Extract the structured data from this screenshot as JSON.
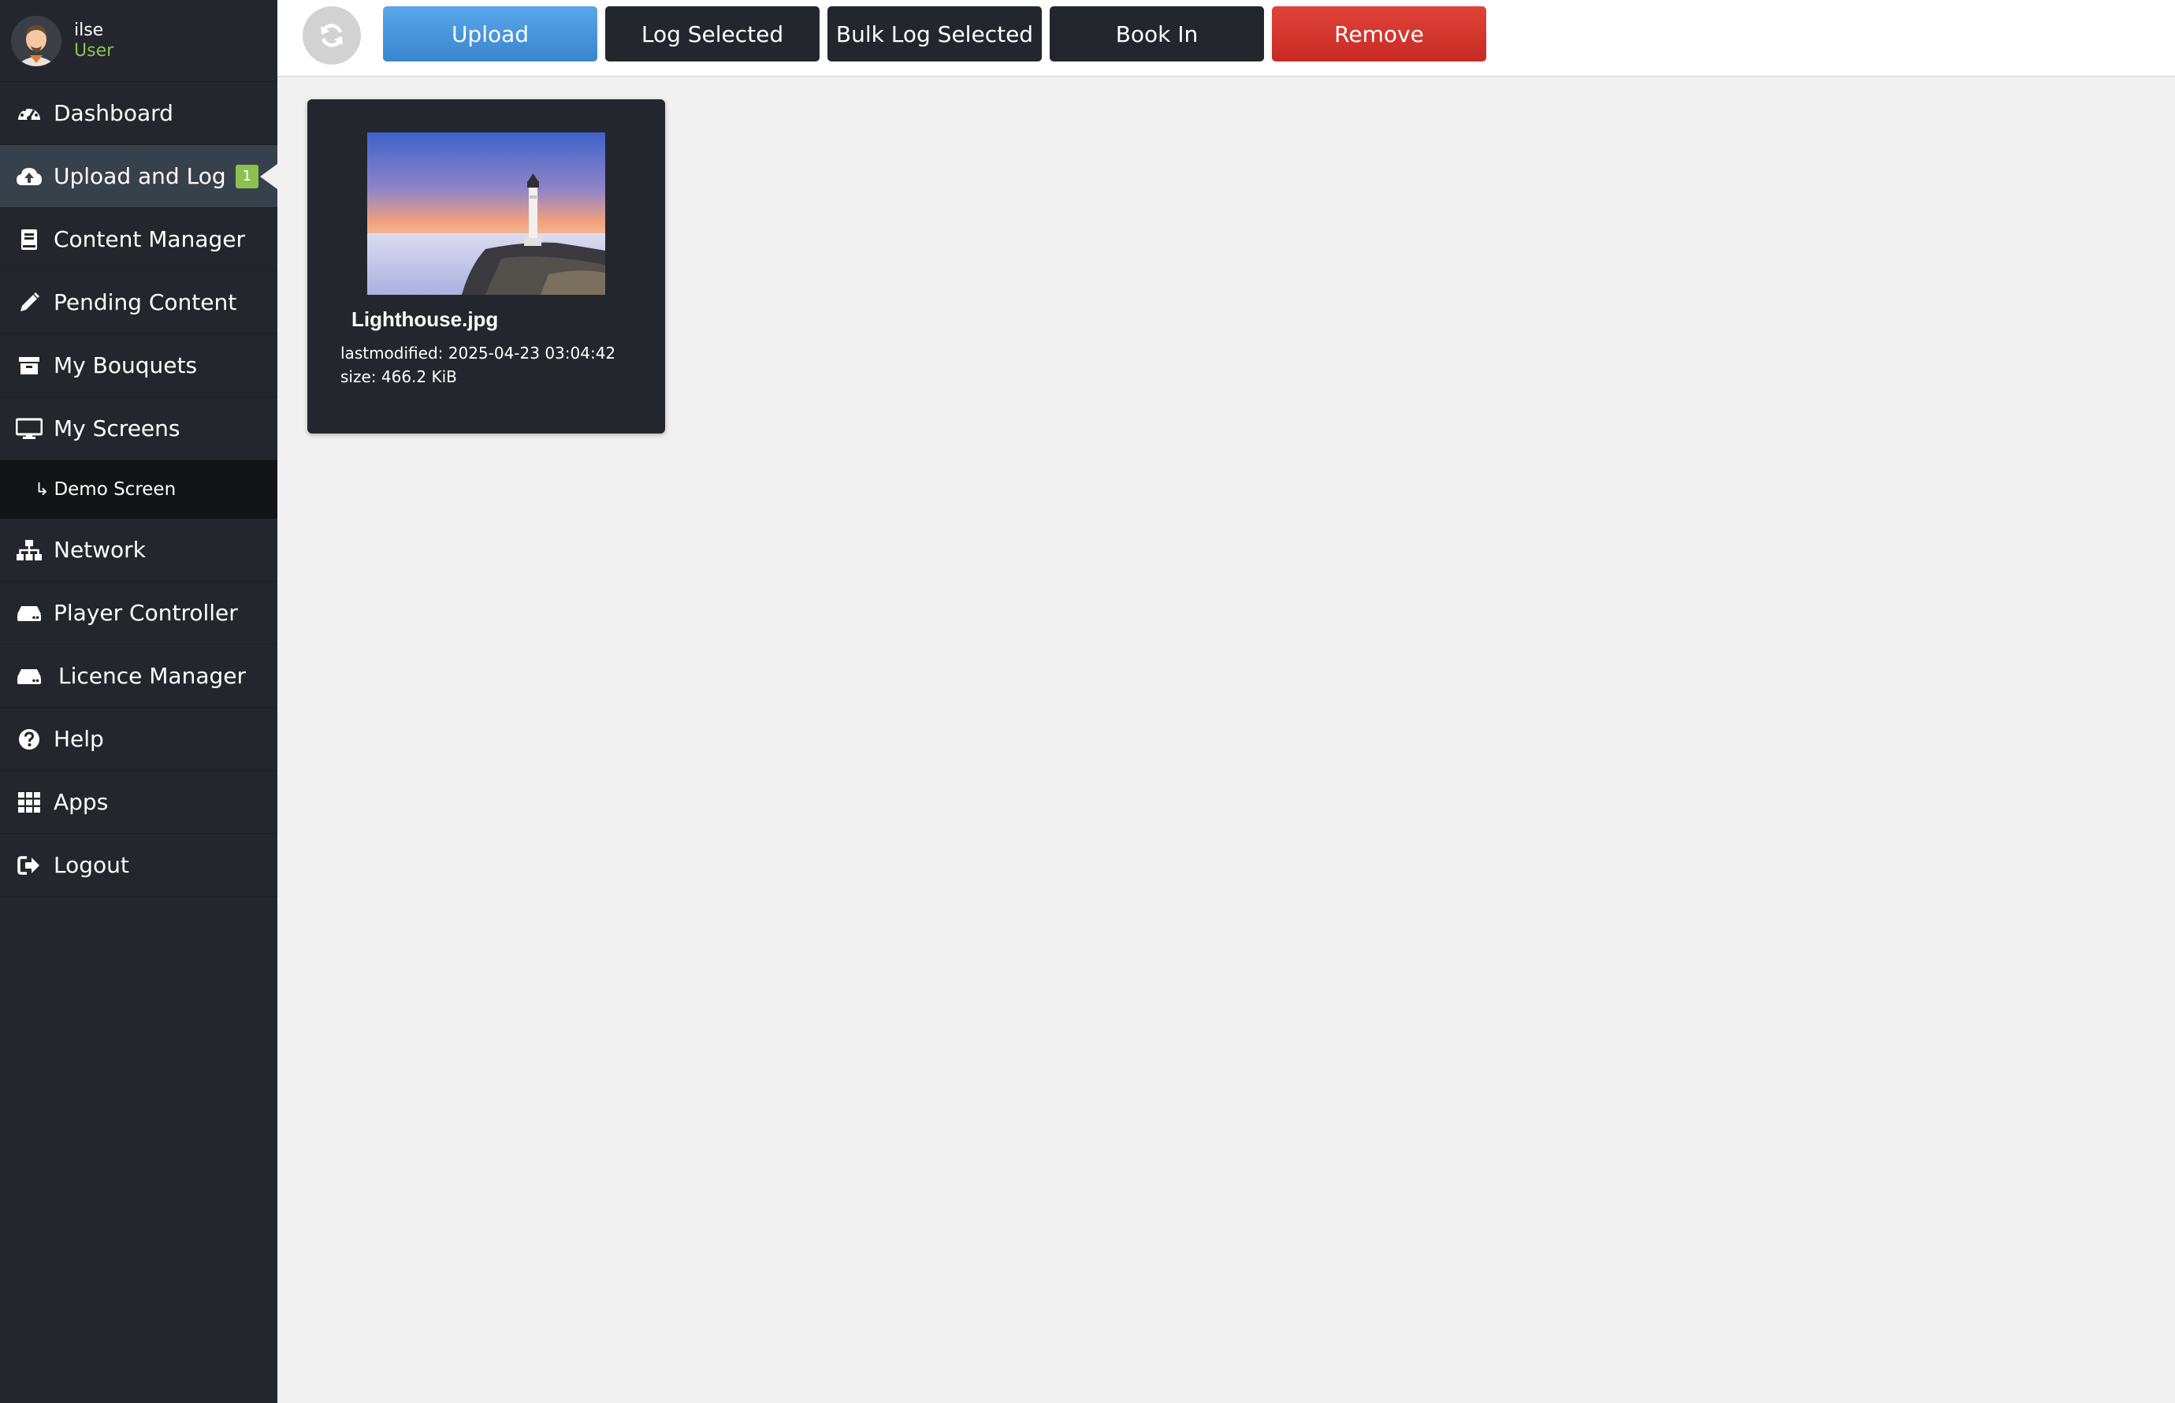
{
  "user": {
    "name": "ilse",
    "role": "User"
  },
  "sidebar": {
    "items": [
      {
        "label": "Dashboard",
        "icon": "dashboard-icon"
      },
      {
        "label": "Upload and Log",
        "icon": "cloud-upload-icon",
        "badge": "1",
        "active": true
      },
      {
        "label": "Content Manager",
        "icon": "book-icon"
      },
      {
        "label": "Pending Content",
        "icon": "pencil-icon"
      },
      {
        "label": "My Bouquets",
        "icon": "archive-icon"
      },
      {
        "label": "My Screens",
        "icon": "monitor-icon"
      },
      {
        "label": "Network",
        "icon": "sitemap-icon"
      },
      {
        "label": "Player Controller",
        "icon": "hdd-icon"
      },
      {
        "label": "Licence Manager",
        "icon": "hdd-icon"
      },
      {
        "label": "Help",
        "icon": "question-circle-icon"
      },
      {
        "label": "Apps",
        "icon": "grid-icon"
      },
      {
        "label": "Logout",
        "icon": "sign-out-icon"
      }
    ],
    "sub_items": [
      {
        "label": "Demo Screen",
        "arrow": "↳"
      }
    ]
  },
  "toolbar": {
    "refresh_icon": "refresh-icon",
    "upload_label": "Upload",
    "log_selected_label": "Log Selected",
    "bulk_log_selected_label": "Bulk Log Selected",
    "book_in_label": "Book In",
    "remove_label": "Remove"
  },
  "files": [
    {
      "name": "Lighthouse.jpg",
      "lastmodified": "lastmodified: 2025-04-23 03:04:42",
      "size": "size: 466.2 KiB"
    }
  ],
  "colors": {
    "sidebar_bg": "#23272d",
    "active_bg": "#37414c",
    "badge": "#8cc152",
    "upload_btn": "#4a96dc",
    "remove_btn": "#d33a31",
    "page_bg": "#f0f0f0"
  }
}
